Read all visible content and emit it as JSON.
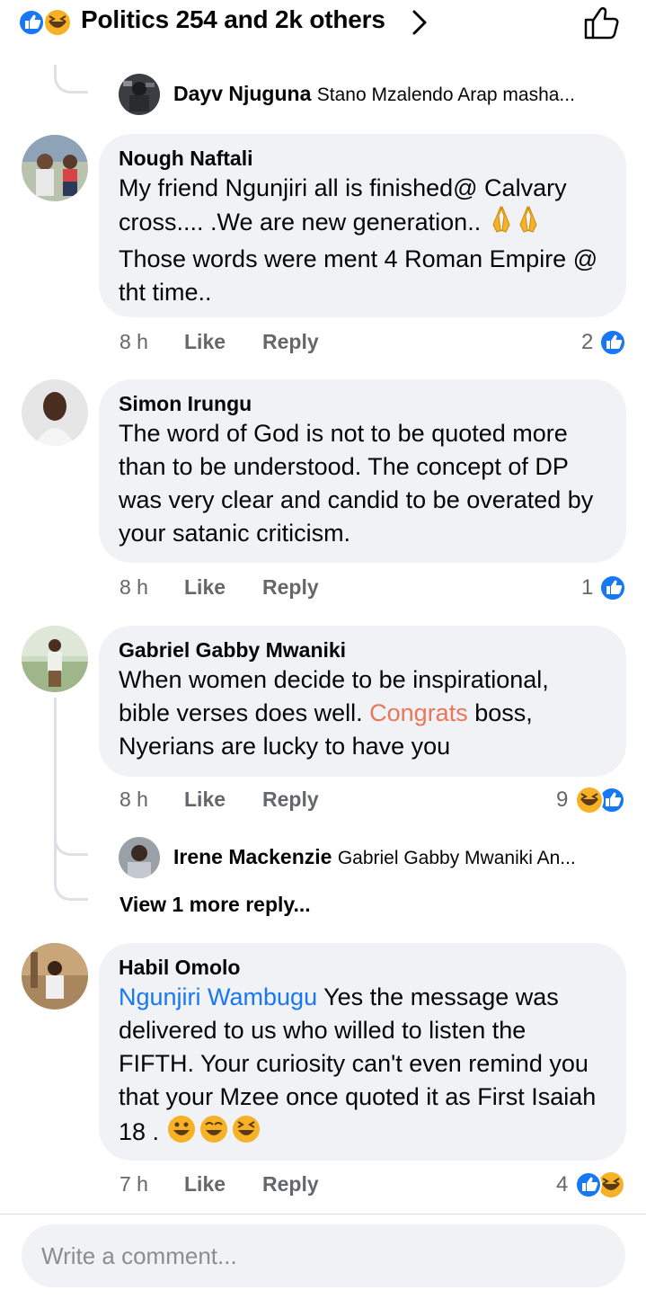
{
  "header": {
    "title": "Politics 254 and 2k others"
  },
  "top_reply": {
    "name": "Dayv Njuguna",
    "text": "Stano Mzalendo  Arap masha..."
  },
  "comments": [
    {
      "author": "Nough Naftali",
      "text_before": "My friend Ngunjiri all is finished@ Calvary cross.... .We are new generation.. ",
      "text_after": "  Those words were ment 4 Roman Empire @ tht time..",
      "time": "8 h",
      "like_label": "Like",
      "reply_label": "Reply",
      "reaction_count": "2"
    },
    {
      "author": "Simon Irungu",
      "text": "The word of God is not to be quoted more than to be understood. The concept of DP was very clear and candid to be overated by your satanic criticism.",
      "time": "8 h",
      "like_label": "Like",
      "reply_label": "Reply",
      "reaction_count": "1"
    },
    {
      "author": "Gabriel Gabby Mwaniki",
      "text_before": "When women decide to be inspirational, bible verses does well. ",
      "highlight": "Congrats",
      "text_after": " boss, Nyerians are lucky to have you",
      "time": "8 h",
      "like_label": "Like",
      "reply_label": "Reply",
      "reaction_count": "9",
      "reply_preview": {
        "name": "Irene Mackenzie",
        "text": "Gabriel Gabby Mwaniki An..."
      },
      "view_more": "View 1 more reply..."
    },
    {
      "author": "Habil Omolo",
      "mention": "Ngunjiri Wambugu",
      "text_after": " Yes the message was delivered to us who willed to listen the FIFTH. Your curiosity can't even remind you that your Mzee once quoted it as First Isaiah 18 . ",
      "time": "7 h",
      "like_label": "Like",
      "reply_label": "Reply",
      "reaction_count": "4"
    }
  ],
  "composer": {
    "placeholder": "Write a comment..."
  },
  "colors": {
    "like_blue": "#1877f2",
    "haha_yellow": "#f7b125",
    "bubble_bg": "#f0f2f5",
    "highlight": "#e9765a",
    "secondary_text": "#65676b"
  }
}
